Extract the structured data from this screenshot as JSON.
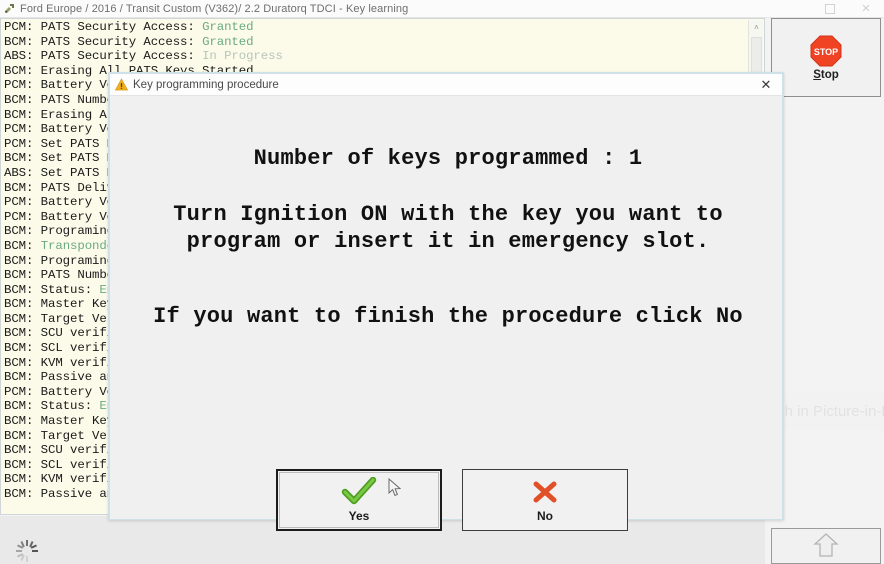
{
  "window": {
    "title": "Ford Europe / 2016 / Transit Custom (V362)/ 2.2 Duratorq TDCI - Key learning",
    "app_icon": "diagnostic-tool-icon",
    "maximize_label": "□",
    "close_label": "✕"
  },
  "log": {
    "entries": [
      {
        "text": "PCM: PATS Security Access: ",
        "value": "Granted",
        "value_style": "ok"
      },
      {
        "text": "BCM: PATS Security Access: ",
        "value": "Granted",
        "value_style": "ok"
      },
      {
        "text": "ABS: PATS Security Access: ",
        "value": "In Progress",
        "value_style": "progress"
      },
      {
        "text": "BCM: Erasing All PATS Keys Started",
        "value": "",
        "value_style": "none"
      },
      {
        "text": "PCM: Battery Voltage",
        "value": "",
        "value_style": "none"
      },
      {
        "text": "BCM: PATS Number",
        "value": "",
        "value_style": "none"
      },
      {
        "text": "BCM: Erasing All",
        "value": "",
        "value_style": "none"
      },
      {
        "text": "PCM: Battery Vol",
        "value": "",
        "value_style": "none"
      },
      {
        "text": "PCM: Set PATS De",
        "value": "",
        "value_style": "none"
      },
      {
        "text": "BCM: Set PATS De",
        "value": "",
        "value_style": "none"
      },
      {
        "text": "ABS: Set PATS De",
        "value": "",
        "value_style": "none"
      },
      {
        "text": "BCM: PATS Delive",
        "value": "",
        "value_style": "none"
      },
      {
        "text": "PCM: Battery Vol",
        "value": "",
        "value_style": "none"
      },
      {
        "text": "PCM: Battery Vol",
        "value": "",
        "value_style": "none"
      },
      {
        "text": "BCM: Programing ",
        "value": "",
        "value_style": "none"
      },
      {
        "text": "BCM: ",
        "value": "Transponder",
        "value_style": "ok"
      },
      {
        "text": "BCM: Programing ",
        "value": "",
        "value_style": "none"
      },
      {
        "text": "BCM: PATS Number",
        "value": "",
        "value_style": "none"
      },
      {
        "text": "BCM: Status: ",
        "value": "Ena",
        "value_style": "ok"
      },
      {
        "text": "BCM: Master Key ",
        "value": "",
        "value_style": "none"
      },
      {
        "text": "BCM: Target Veri",
        "value": "",
        "value_style": "none"
      },
      {
        "text": "BCM: SCU verifie",
        "value": "",
        "value_style": "none"
      },
      {
        "text": "BCM: SCL verifie",
        "value": "",
        "value_style": "none"
      },
      {
        "text": "BCM: KVM verifie",
        "value": "",
        "value_style": "none"
      },
      {
        "text": "BCM: Passive ant",
        "value": "",
        "value_style": "none"
      },
      {
        "text": "PCM: Battery Vol",
        "value": "",
        "value_style": "none"
      },
      {
        "text": "BCM: Status: ",
        "value": "Ena",
        "value_style": "ok"
      },
      {
        "text": "BCM: Master Key ",
        "value": "",
        "value_style": "none"
      },
      {
        "text": "BCM: Target Veri",
        "value": "",
        "value_style": "none"
      },
      {
        "text": "BCM: SCU verifie",
        "value": "",
        "value_style": "none"
      },
      {
        "text": "BCM: SCL verifie",
        "value": "",
        "value_style": "none"
      },
      {
        "text": "BCM: KVM verifie",
        "value": "",
        "value_style": "none"
      },
      {
        "text": "BCM: Passive ant",
        "value": "",
        "value_style": "none"
      }
    ],
    "colors": {
      "granted": "#6aab82",
      "in_progress": "#b6c6bb",
      "background": "#fcfbe9"
    },
    "scrollbar": {
      "up_arrow": "˄"
    }
  },
  "toolbar": {
    "stop_button": {
      "label_mnemonic": "S",
      "label_rest": "top",
      "icon": "stop-sign-icon",
      "icon_text": "STOP"
    },
    "scroll_up_button": {
      "icon": "up-arrow-icon"
    }
  },
  "pip_overlay": {
    "label": "Watch in Picture-in-Picture",
    "icon": "picture-in-picture-icon"
  },
  "dialog": {
    "title": "Key programming procedure",
    "title_icon": "warning-triangle-icon",
    "close_label": "✕",
    "message_1": "Number of keys programmed : 1",
    "message_2_line_1": "Turn Ignition ON with the key you want to",
    "message_2_line_2": "program or insert it in emergency slot.",
    "message_3": "If you want to finish the procedure click No",
    "buttons": {
      "yes": {
        "label": "Yes",
        "icon": "green-check-icon"
      },
      "no": {
        "label": "No",
        "icon": "red-cross-icon"
      }
    }
  },
  "status": {
    "spinner": "loading-spinner"
  }
}
